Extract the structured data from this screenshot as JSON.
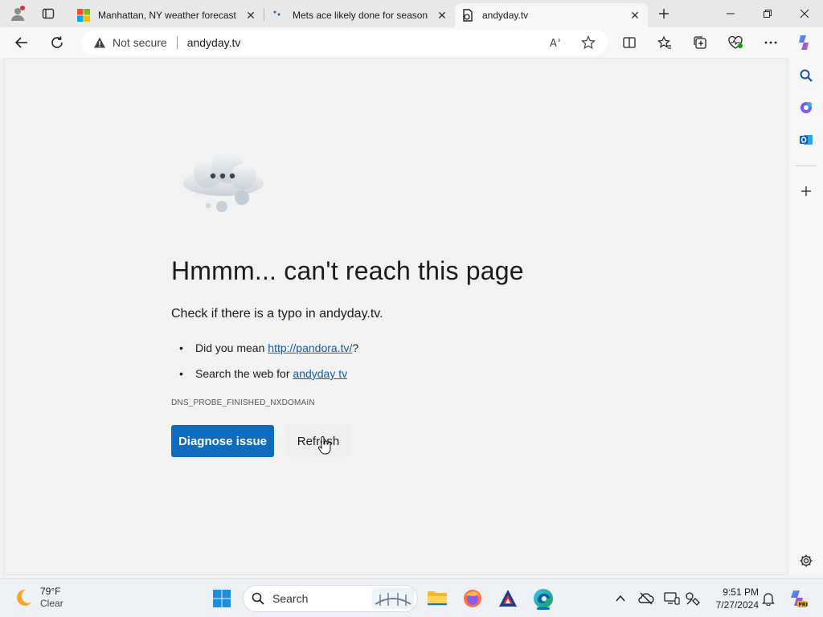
{
  "tabs": [
    {
      "title": "Manhattan, NY weather forecast",
      "active": false
    },
    {
      "title": "Mets ace likely done for season",
      "active": false
    },
    {
      "title": "andyday.tv",
      "active": true
    }
  ],
  "address_bar": {
    "security_label": "Not secure",
    "url": "andyday.tv"
  },
  "error_page": {
    "title": "Hmmm... can't reach this page",
    "subtitle": "Check if there is a typo in andyday.tv.",
    "suggestion_1_prefix": "Did you mean ",
    "suggestion_1_link": "http://pandora.tv/",
    "suggestion_1_suffix": "?",
    "suggestion_2_prefix": "Search the web for ",
    "suggestion_2_link": "andyday tv",
    "error_code": "DNS_PROBE_FINISHED_NXDOMAIN",
    "primary_button": "Diagnose issue",
    "secondary_button": "Refresh"
  },
  "taskbar": {
    "weather_temp": "79°F",
    "weather_condition": "Clear",
    "search_placeholder": "Search",
    "time": "9:51 PM",
    "date": "7/27/2024"
  },
  "colors": {
    "accent": "#0f6cbd",
    "link": "#0e5ea6",
    "page_bg": "#f2f2f2"
  }
}
